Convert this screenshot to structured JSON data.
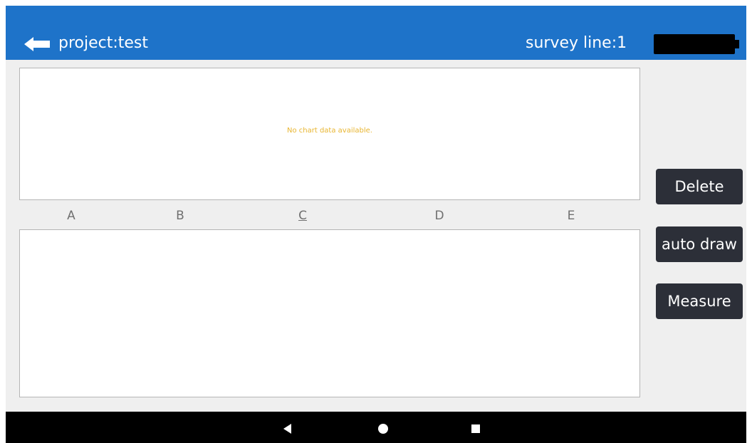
{
  "app_bar": {
    "project_title": "project:test",
    "survey_line": "survey line:1",
    "back_icon": "arrow-left-icon",
    "battery_icon": "battery-icon",
    "colors": {
      "background": "#1e73c9",
      "text": "#ffffff"
    }
  },
  "chart": {
    "empty_message": "No chart data available.",
    "empty_message_color": "#e8b530"
  },
  "tabs": {
    "items": [
      {
        "label": "A"
      },
      {
        "label": "B"
      },
      {
        "label": "C"
      },
      {
        "label": "D"
      },
      {
        "label": "E"
      }
    ],
    "active": "C"
  },
  "actions": {
    "delete_label": "Delete",
    "auto_draw_label": "auto draw",
    "measure_label": "Measure",
    "button_color": "#2c2f38"
  },
  "nav_bar": {
    "back_icon": "triangle-back-icon",
    "home_icon": "circle-home-icon",
    "recent_icon": "square-recents-icon"
  }
}
